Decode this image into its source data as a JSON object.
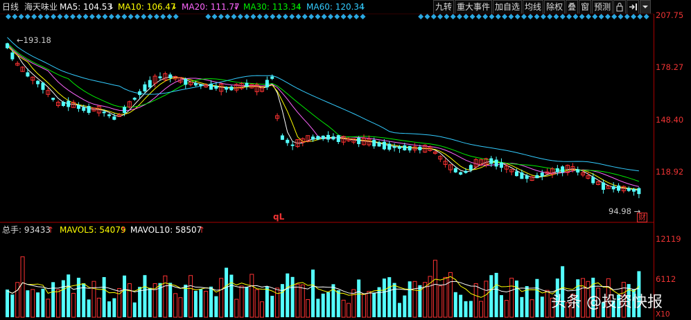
{
  "header": {
    "period": "日线",
    "name": "海天味业",
    "ma": [
      {
        "label": "MA5: 104.53",
        "arrow": "↓",
        "color": "#ffffff"
      },
      {
        "label": "MA10: 106.47",
        "arrow": "↓",
        "color": "#ffff00"
      },
      {
        "label": "MA20: 111.77",
        "arrow": "↓",
        "color": "#ff66ff"
      },
      {
        "label": "MA30: 113.34",
        "arrow": "↓",
        "color": "#00ee00"
      },
      {
        "label": "MA60: 120.34",
        "arrow": "↓",
        "color": "#33ccff"
      }
    ]
  },
  "toolbar": {
    "buttons": [
      "九转",
      "重大事件",
      "加自选",
      "均线",
      "除权",
      "叠",
      "窗",
      "预测"
    ],
    "icons": [
      "lock-icon",
      "exit-fullscreen-icon",
      "dropdown-icon"
    ]
  },
  "price_axis": {
    "labels": [
      "207.75",
      "178.27",
      "148.40",
      "118.92"
    ]
  },
  "volume": {
    "label": "总手: 93433",
    "mavol5": "MAVOL5: 54079",
    "mavol10": "MAVOL10: 58507",
    "axis_labels": [
      "12119",
      "6112"
    ],
    "unit": "X10"
  },
  "annotations": {
    "high": "←193.18",
    "low": "94.98 →",
    "cai": "财",
    "ql": "qL"
  },
  "watermark": "头条 @投资快报",
  "colors": {
    "up": "#ff3333",
    "down": "#54ffff",
    "axis": "#aa0000",
    "marker": "#2aa7e0"
  }
}
